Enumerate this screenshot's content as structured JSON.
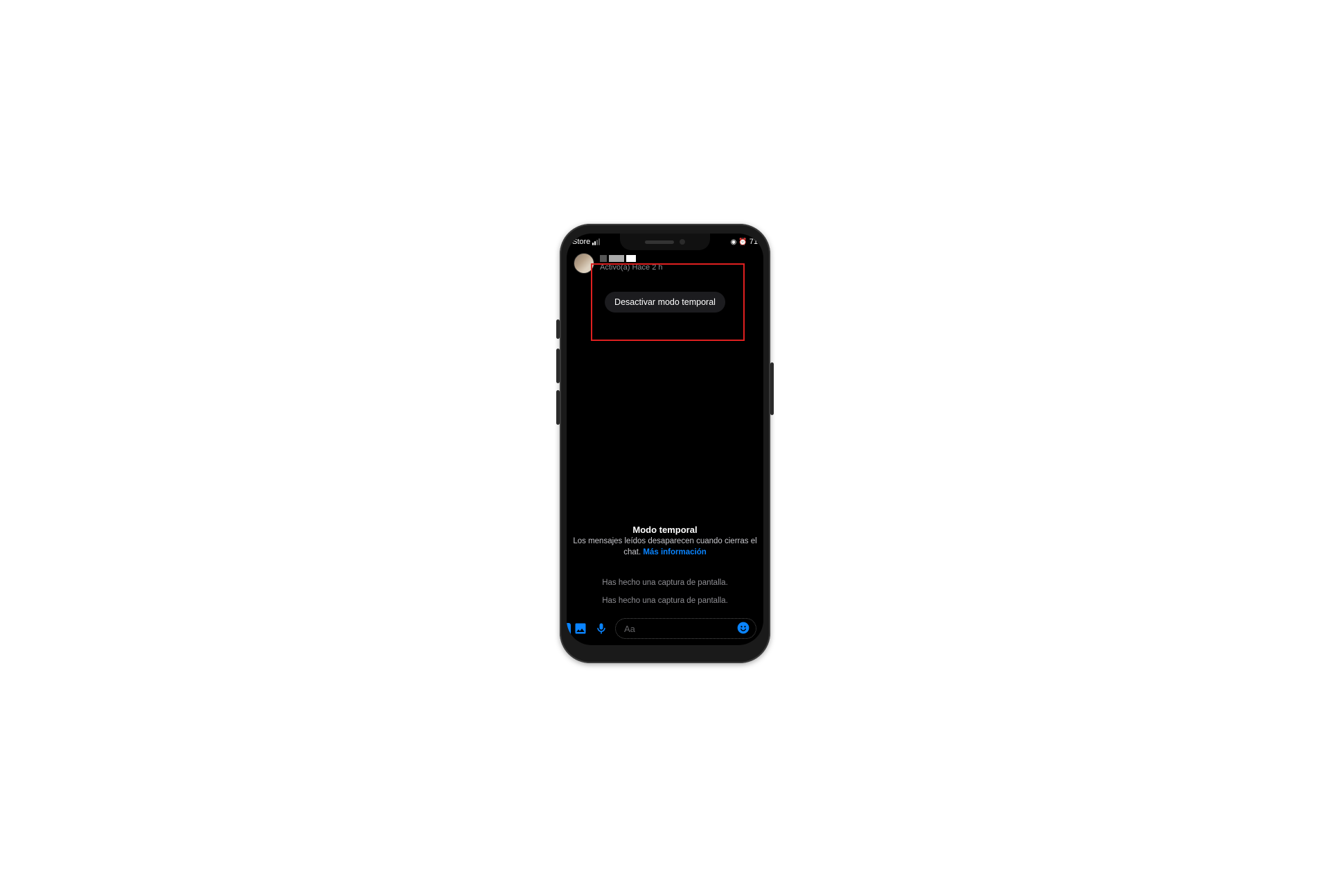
{
  "status": {
    "left_label": "Store",
    "battery_text": "71"
  },
  "header": {
    "activity": "Activo(a) Hace 2 h"
  },
  "vanish_pill": "Desactivar modo temporal",
  "info": {
    "title": "Modo temporal",
    "body_prefix": "Los mensajes leídos desaparecen cuando cierras el chat. ",
    "link": "Más información"
  },
  "system_messages": [
    "Has hecho una captura de pantalla.",
    "Has hecho una captura de pantalla."
  ],
  "composer": {
    "placeholder": "Aa"
  }
}
